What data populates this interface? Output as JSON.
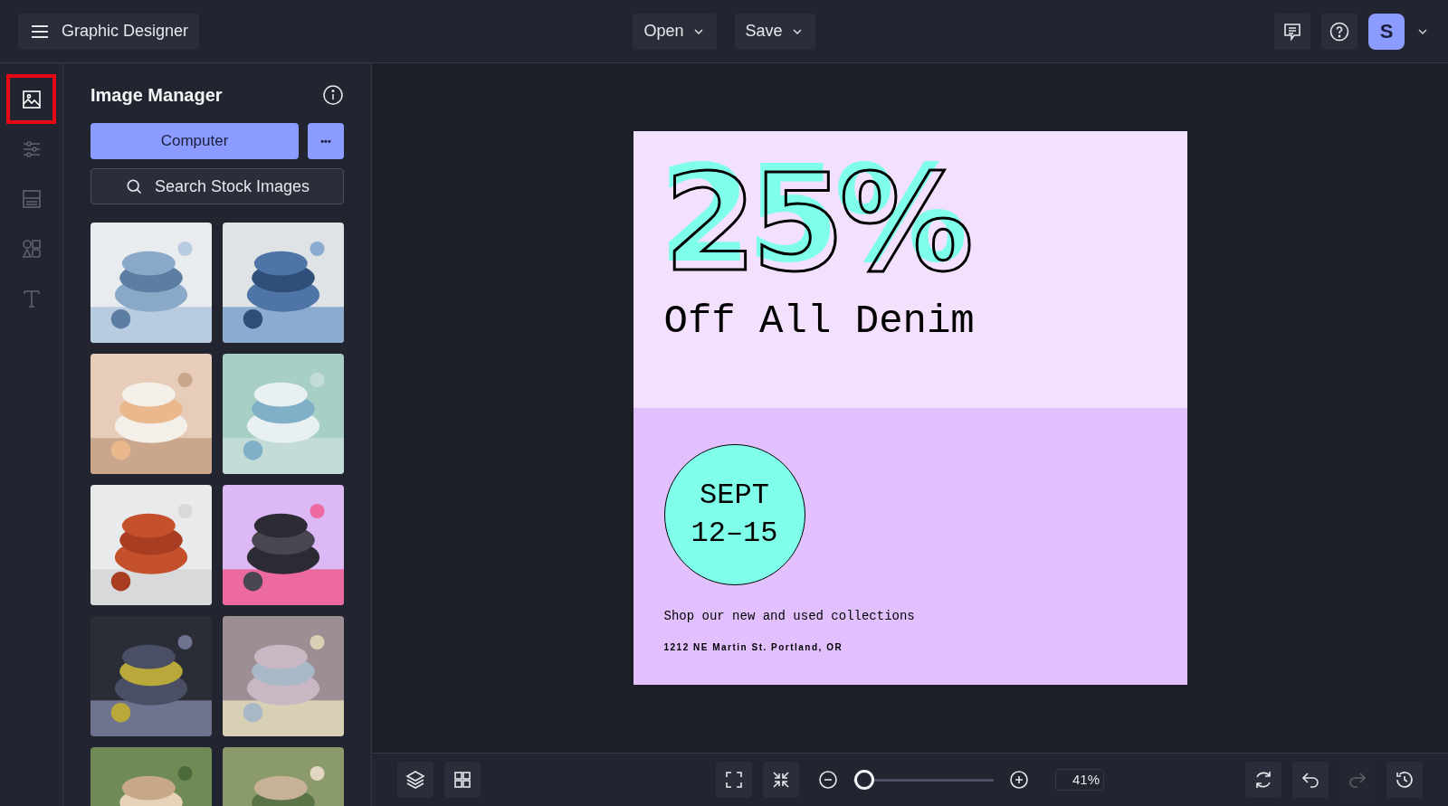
{
  "app": {
    "title": "Graphic Designer"
  },
  "top_menu": [
    {
      "label": "Open"
    },
    {
      "label": "Save"
    }
  ],
  "avatar": {
    "initial": "S"
  },
  "sidebar": {
    "items": [
      {
        "selected": true
      },
      {
        "selected": false
      },
      {
        "selected": false
      },
      {
        "selected": false
      },
      {
        "selected": false
      }
    ]
  },
  "panel": {
    "title": "Image Manager",
    "upload_button": "Computer",
    "more_button": "•••",
    "search": {
      "placeholder": "Search Stock Images"
    }
  },
  "poster": {
    "headline": "25%",
    "subhead": "Off All Denim",
    "date_line_1": "SEPT",
    "date_line_2": "12–15",
    "tagline": "Shop our new and used collections",
    "address": "1212 NE Martin St. Portland, OR"
  },
  "zoom": {
    "level": 0.08,
    "reading": "41%"
  },
  "history": {
    "undo_disabled": false,
    "redo_disabled": true
  }
}
